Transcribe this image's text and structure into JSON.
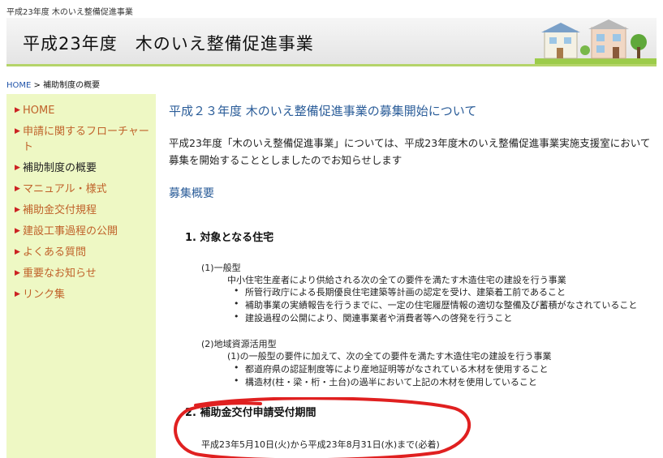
{
  "top_caption": "平成23年度 木のいえ整備促進事業",
  "banner": {
    "title": "平成23年度　木のいえ整備促進事業"
  },
  "breadcrumb": {
    "home": "HOME",
    "separator": " > ",
    "current": "補助制度の概要"
  },
  "sidebar": {
    "items": [
      {
        "label": "HOME"
      },
      {
        "label": "申請に関するフローチャート"
      },
      {
        "label": "補助制度の概要"
      },
      {
        "label": "マニュアル・様式"
      },
      {
        "label": "補助金交付規程"
      },
      {
        "label": "建設工事過程の公開"
      },
      {
        "label": "よくある質問"
      },
      {
        "label": "重要なお知らせ"
      },
      {
        "label": "リンク集"
      }
    ]
  },
  "main": {
    "heading": "平成２３年度 木のいえ整備促進事業の募集開始について",
    "intro": "平成23年度「木のいえ整備促進事業」については、平成23年度木のいえ整備促進事業実施支援室において募集を開始することとしましたのでお知らせします",
    "subheading": "募集概要",
    "section1": {
      "title": "1.  対象となる住宅",
      "general": {
        "label": "(1)一般型",
        "desc": "中小住宅生産者により供給される次の全ての要件を満たす木造住宅の建設を行う事業",
        "reqs": [
          "所管行政庁による長期優良住宅建築等計画の認定を受け、建築着工前であること",
          "補助事業の実績報告を行うまでに、一定の住宅履歴情報の適切な整備及び蓄積がなされていること",
          "建設過程の公開により、関連事業者や消費者等への啓発を行うこと"
        ]
      },
      "regional": {
        "label": "(2)地域資源活用型",
        "desc": "(1)の一般型の要件に加えて、次の全ての要件を満たす木造住宅の建設を行う事業",
        "reqs": [
          "都道府県の認証制度等により産地証明等がなされている木材を使用すること",
          "構造材(柱・梁・桁・土台)の過半において上記の木材を使用していること"
        ]
      }
    },
    "section2": {
      "title": "2.  補助金交付申請受付期間",
      "period": "平成23年5月10日(火)から平成23年8月31日(水)まで(必着)"
    },
    "bullet_char": "•",
    "nav_bullet": "▶"
  },
  "colors": {
    "link": "#2b5d99",
    "nav_text": "#c0622a",
    "sidebar_bg": "#eef8c4",
    "highlight": "#e02020"
  }
}
